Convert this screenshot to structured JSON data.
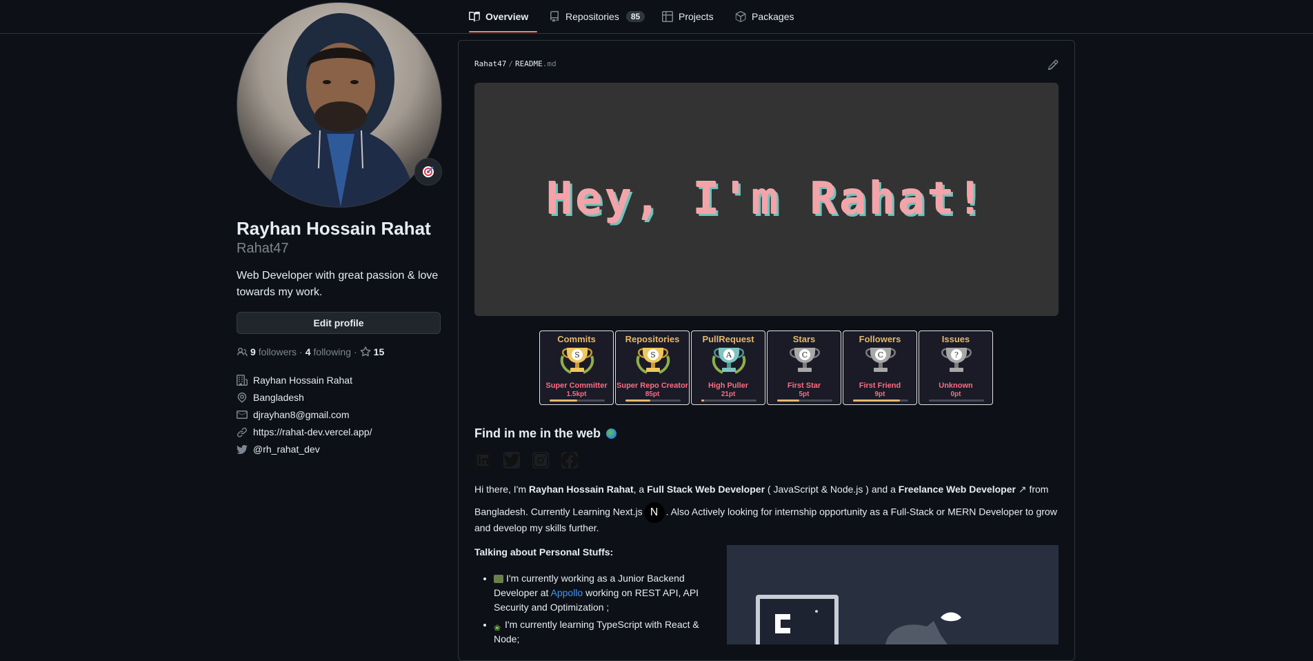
{
  "nav": {
    "tabs": [
      {
        "label": "Overview",
        "icon": "book-icon",
        "active": true
      },
      {
        "label": "Repositories",
        "icon": "repo-icon",
        "count": "85"
      },
      {
        "label": "Projects",
        "icon": "table-icon"
      },
      {
        "label": "Packages",
        "icon": "package-icon"
      }
    ]
  },
  "profile": {
    "fullname": "Rayhan Hossain Rahat",
    "username": "Rahat47",
    "bio": "Web Developer with great passion & love towards my work.",
    "edit_label": "Edit profile",
    "followers_count": "9",
    "followers_label": "followers",
    "following_count": "4",
    "following_label": "following",
    "stars_count": "15",
    "company": "Rayhan Hossain Rahat",
    "location": "Bangladesh",
    "email": "djrayhan8@gmail.com",
    "website": "https://rahat-dev.vercel.app/",
    "twitter": "@rh_rahat_dev"
  },
  "readme": {
    "owner": "Rahat47",
    "file": "README",
    "ext": ".md",
    "banner_text": "Hey, I'm Rahat!",
    "trophies": [
      {
        "title": "Commits",
        "rank": "S",
        "name": "Super Committer",
        "points": "1.5kpt",
        "progress": 0.5,
        "color": "gold"
      },
      {
        "title": "Repositories",
        "rank": "S",
        "name": "Super Repo Creator",
        "points": "85pt",
        "progress": 0.45,
        "color": "gold"
      },
      {
        "title": "PullRequest",
        "rank": "A",
        "name": "High Puller",
        "points": "21pt",
        "progress": 0.05,
        "color": "teal"
      },
      {
        "title": "Stars",
        "rank": "C",
        "name": "First Star",
        "points": "5pt",
        "progress": 0.4,
        "color": "silver"
      },
      {
        "title": "Followers",
        "rank": "C",
        "name": "First Friend",
        "points": "9pt",
        "progress": 0.85,
        "color": "silver"
      },
      {
        "title": "Issues",
        "rank": "?",
        "name": "Unknown",
        "points": "0pt",
        "progress": 0,
        "color": "silver"
      }
    ],
    "find_heading": "Find in me in the web",
    "intro_1": "Hi there, I'm",
    "intro_name": "Rayhan Hossain Rahat",
    "intro_2": ", a",
    "intro_role": "Full Stack Web Developer",
    "intro_3": "( JavaScript & Node.js ) and a",
    "intro_role2": "Freelance Web Developer",
    "intro_4": "from",
    "intro_5": "Bangladesh. Currently Learning Next.js",
    "next_badge": "N",
    "intro_6": ". Also Actively looking for internship opportunity as a Full-Stack or MERN Developer to grow",
    "intro_7": "and develop my skills further.",
    "talk_heading": "Talking about Personal Stuffs:",
    "item1_a": "I'm currently working as a Junior Backend Developer at",
    "item1_link": "Appollo",
    "item1_b": "working on REST API, API Security and Optimization ;",
    "item2": "I'm currently learning TypeScript with React & Node;"
  }
}
